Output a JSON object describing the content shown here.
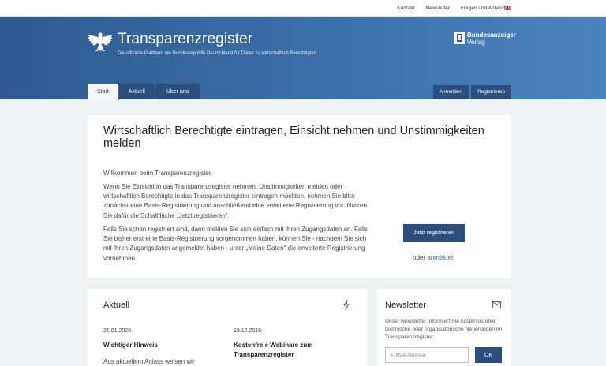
{
  "topbar": {
    "links": [
      "Kontakt",
      "Newsletter",
      "Fragen und Antworten"
    ],
    "flag_icon": "uk-flag-icon"
  },
  "header": {
    "title": "Transparenzregister",
    "subtitle": "Die offizielle Plattform der Bundesrepublik Deutschland für Daten zu wirtschaftlich Berechtigten",
    "publisher_name": "Bundesanzeiger",
    "publisher_sub": "Verlag"
  },
  "nav": {
    "tabs": [
      "Start",
      "Aktuell",
      "Über uns"
    ],
    "active_tab": "Start",
    "login": "Anmelden",
    "register": "Registrieren"
  },
  "main": {
    "title": "Wirtschaftlich Berechtigte eintragen, Einsicht nehmen und Unstimmigkeiten melden",
    "para1": "Willkommen beim Transparenzregister.",
    "para2": "Wenn Sie Einsicht in das Transparenzregister nehmen, Unstimmigkeiten melden oder wirtschaftlich Berechtigte in das Transparenzregister eintragen möchten, nehmen Sie bitte zunächst eine Basis-Registrierung und anschließend eine erweiterte Registrierung vor. Nutzen Sie dafür die Schaltfläche „Jetzt registrieren\".",
    "para3": "Falls Sie schon registriert sind, dann melden Sie sich einfach mit Ihren Zugangsdaten an. Falls Sie bisher erst eine Basis-Registrierung vorgenommen haben, können Sie - nachdem Sie sich mit Ihren Zugangsdaten angemeldet haben - unter „Meine Daten\" die erweiterte Registrierung vornehmen.",
    "cta": "Jetzt registrieren",
    "or_text": "oder",
    "login_link": "anmelden"
  },
  "aktuell": {
    "title": "Aktuell",
    "items": [
      {
        "date": "21.01.2020",
        "headline": "Wichtiger Hinweis",
        "teaser": "Aus aktuellem Anlass weisen wir"
      },
      {
        "date": "19.12.2019",
        "headline": "Kostenfreie Webinare zum Transparenzregister"
      }
    ]
  },
  "newsletter": {
    "title": "Newsletter",
    "text": "Unser Newsletter informiert Sie kostenlos über technische oder organisatorische Neuerungen im Transparenzregister.",
    "placeholder": "E-Mail-Adresse",
    "button": "OK"
  },
  "colors": {
    "header_start": "#2e5a91",
    "header_end": "#4b82c0",
    "nav_dark": "#2a4f7d",
    "link": "#2f6aa8"
  }
}
